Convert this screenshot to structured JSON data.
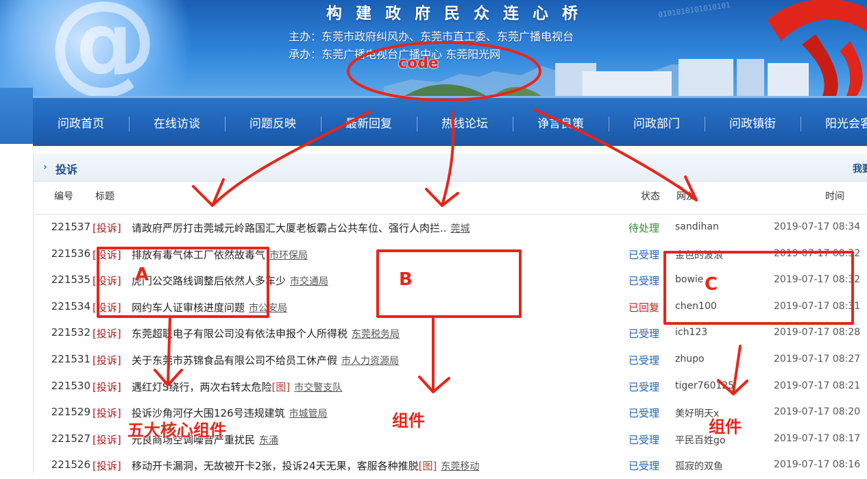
{
  "banner": {
    "slogan": "构 建 政 府 民 众 连 心 桥",
    "organizer": "主办：东莞市政府纠风办、东莞市直工委、东莞广播电视台",
    "undertaker": "承办：东莞广播电视台广播中心  东莞阳光网",
    "binary": "0101010101010101"
  },
  "nav": {
    "items": [
      "问政首页",
      "在线访谈",
      "问题反映",
      "最新回复",
      "热线论坛",
      "诤言良策",
      "问政部门",
      "问政镇街",
      "阳光会客"
    ]
  },
  "section": {
    "title": "投诉",
    "more": "我要"
  },
  "columns": {
    "number": "编号",
    "title": "标题",
    "status": "状态",
    "user": "网友",
    "time": "时间"
  },
  "rows": [
    {
      "num": "221537",
      "tag": "[投诉]",
      "title": "请政府严厉打击莞城元岭路国汇大厦老板霸占公共车位、强行人肉拦..",
      "pic": "",
      "dept": "莞城",
      "status": "待处理",
      "status_kind": "pending",
      "user": "sandihan",
      "time": "2019-07-17 08:34"
    },
    {
      "num": "221536",
      "tag": "[投诉]",
      "title": "排放有毒气体工厂依然故毒气",
      "pic": "",
      "dept": "市环保局",
      "status": "已受理",
      "status_kind": "accepted",
      "user": "金色的波浪",
      "time": "2019-07-17 08:32"
    },
    {
      "num": "221535",
      "tag": "[投诉]",
      "title": "虎门公交路线调整后依然人多车少",
      "pic": "",
      "dept": "市交通局",
      "status": "已受理",
      "status_kind": "accepted",
      "user": "bowie",
      "time": "2019-07-17 08:32"
    },
    {
      "num": "221534",
      "tag": "[投诉]",
      "title": "网约车人证审核进度问题",
      "pic": "",
      "dept": "市公安局",
      "status": "已回复",
      "status_kind": "replied",
      "user": "chen100",
      "time": "2019-07-17 08:31"
    },
    {
      "num": "221532",
      "tag": "[投诉]",
      "title": "东莞超联电子有限公司没有依法申报个人所得税",
      "pic": "",
      "dept": "东莞税务局",
      "status": "已受理",
      "status_kind": "accepted",
      "user": "ich123",
      "time": "2019-07-17 08:28"
    },
    {
      "num": "221531",
      "tag": "[投诉]",
      "title": "关于东莞市苏锦食品有限公司不给员工休产假",
      "pic": "",
      "dept": "市人力资源局",
      "status": "已受理",
      "status_kind": "accepted",
      "user": "zhupo",
      "time": "2019-07-17 08:27"
    },
    {
      "num": "221530",
      "tag": "[投诉]",
      "title": "遇红灯S绕行，两次右转太危险",
      "pic": "[图]",
      "dept": "市交警支队",
      "status": "已受理",
      "status_kind": "accepted",
      "user": "tiger760125",
      "time": "2019-07-17 08:21"
    },
    {
      "num": "221529",
      "tag": "[投诉]",
      "title": "投诉沙角河仔大围126号违规建筑",
      "pic": "",
      "dept": "市城管局",
      "status": "已受理",
      "status_kind": "accepted",
      "user": "美好明天x",
      "time": "2019-07-17 08:20"
    },
    {
      "num": "221527",
      "tag": "[投诉]",
      "title": "元良商场空调噪音严重扰民",
      "pic": "",
      "dept": "东涌",
      "status": "已受理",
      "status_kind": "accepted",
      "user": "平民百姓go",
      "time": "2019-07-17 08:17"
    },
    {
      "num": "221526",
      "tag": "[投诉]",
      "title": "移动开卡漏洞，无故被开卡2张，投诉24天无果，客服各种推脱",
      "pic": "[图]",
      "dept": "东莞移动",
      "status": "已受理",
      "status_kind": "accepted",
      "user": "孤寂的双鱼",
      "time": "2019-07-17 08:16"
    }
  ],
  "annotations": {
    "code": "code",
    "a": "A",
    "b": "B",
    "c": "C",
    "five_core": "五大核心组件",
    "component_b": "组件",
    "component_c": "组件"
  },
  "colors": {
    "annotation_red": "#e8251a",
    "nav_blue": "#1f62b6",
    "banner_blue": "#2f86dc",
    "tag_red": "#b01818"
  }
}
